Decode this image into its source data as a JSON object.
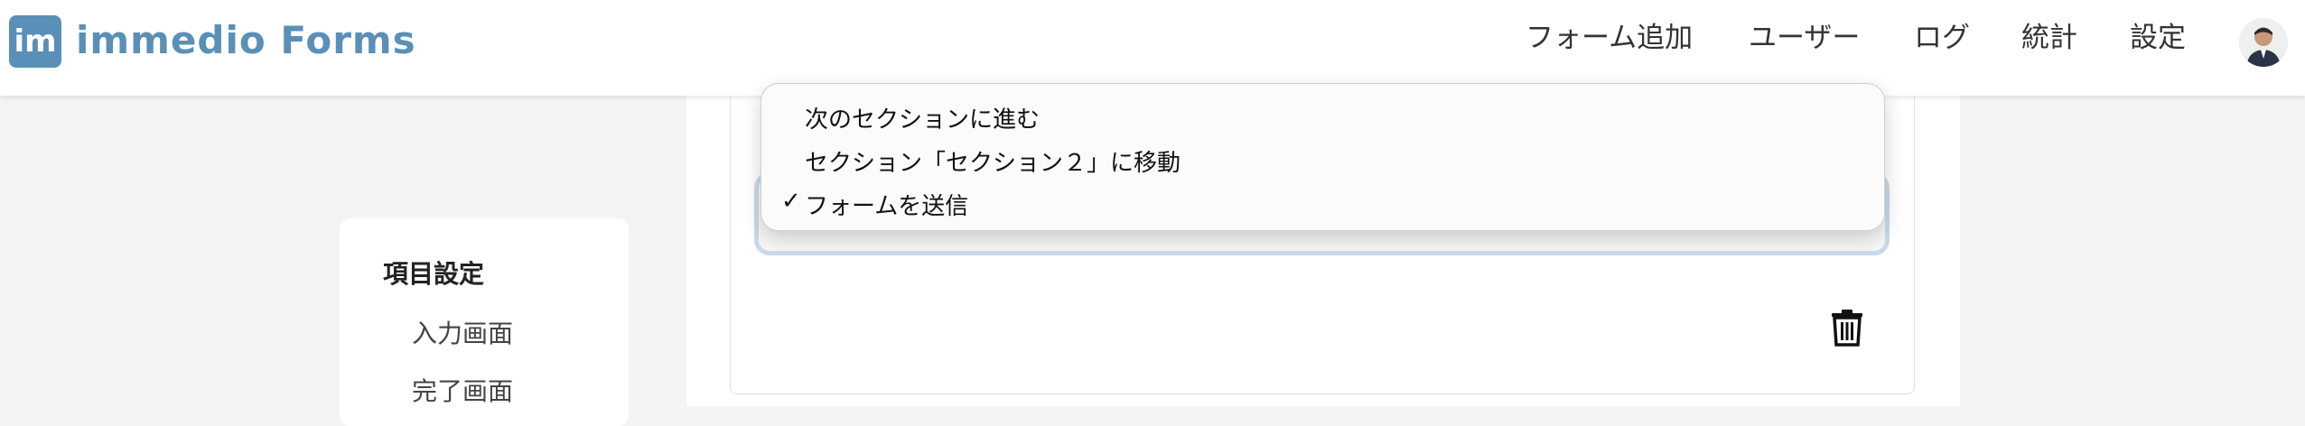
{
  "app": {
    "logo_mark": "im",
    "title": "immedio Forms"
  },
  "nav": {
    "add_form": "フォーム追加",
    "users": "ユーザー",
    "logs": "ログ",
    "stats": "統計",
    "settings": "設定"
  },
  "sidebar": {
    "heading": "項目設定",
    "items": [
      {
        "label": "入力画面"
      },
      {
        "label": "完了画面"
      }
    ]
  },
  "dropdown": {
    "options": [
      {
        "label": "次のセクションに進む",
        "selected": false
      },
      {
        "label": "セクション「セクション２」に移動",
        "selected": false
      },
      {
        "label": "フォームを送信",
        "selected": true
      }
    ],
    "check_glyph": "✓"
  },
  "colors": {
    "brand": "#5a8fb8",
    "focus_ring": "#c9dae8"
  },
  "icons": {
    "delete": "trash-icon"
  }
}
